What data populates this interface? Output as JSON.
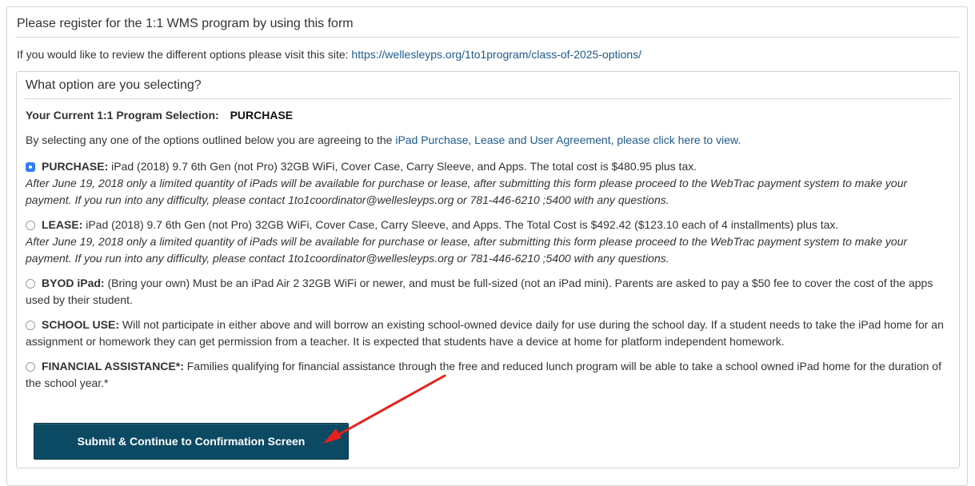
{
  "header": {
    "title": "Please register for the 1:1 WMS program by using this form",
    "intro_text": "If you would like to review the different options please visit this site:",
    "intro_link": "https://wellesleyps.org/1to1program/class-of-2025-options/"
  },
  "form": {
    "title": "What option are you selecting?",
    "current_selection_label": "Your Current 1:1 Program Selection:",
    "current_selection_value": "PURCHASE",
    "agree_prefix": "By selecting any one of the options outlined below you are agreeing to the",
    "agree_link": "iPad Purchase, Lease and User Agreement, please click here to view.",
    "options": [
      {
        "label": "PURCHASE:",
        "text": "iPad (2018) 9.7 6th Gen (not Pro) 32GB WiFi, Cover Case, Carry Sleeve, and Apps. The total cost is $480.95 plus tax.",
        "note": "After June 19, 2018 only a limited quantity of iPads will be available for purchase or lease, after submitting this form please proceed to the WebTrac payment system to make your payment. If you run into any difficulty, please contact 1to1coordinator@wellesleyps.org or 781-446-6210 ;5400 with any questions.",
        "selected": true
      },
      {
        "label": "LEASE:",
        "text": "iPad (2018) 9.7 6th Gen (not Pro) 32GB WiFi, Cover Case, Carry Sleeve, and Apps. The Total Cost is $492.42 ($123.10 each of 4 installments) plus tax.",
        "note": "After June 19, 2018 only a limited quantity of iPads will be available for purchase or lease, after submitting this form please proceed to the WebTrac payment system to make your payment. If you run into any difficulty, please contact 1to1coordinator@wellesleyps.org or 781-446-6210 ;5400 with any questions.",
        "selected": false
      },
      {
        "label": "BYOD iPad:",
        "text": "(Bring your own) Must be an iPad Air 2 32GB WiFi or newer, and must be full-sized (not an iPad mini). Parents are asked to pay a $50 fee to cover the cost of the apps used by their student.",
        "selected": false
      },
      {
        "label": "SCHOOL USE:",
        "text": "Will not participate in either above and will borrow an existing school-owned device daily for use during the school day. If a student needs to take the iPad home for an assignment or homework they can get permission from a teacher. It is expected that students have a device at home for platform independent homework.",
        "selected": false
      },
      {
        "label": "FINANCIAL ASSISTANCE*:",
        "text": "Families qualifying for financial assistance through the free and reduced lunch program will be able to take a school owned iPad home for the duration of the school year.*",
        "selected": false
      }
    ],
    "submit_label": "Submit & Continue to Confirmation Screen"
  },
  "colors": {
    "link": "#1f5a8a",
    "button": "#0c4a63",
    "radio_checked": "#2f7ff5",
    "annotation_arrow": "#e8201b"
  }
}
